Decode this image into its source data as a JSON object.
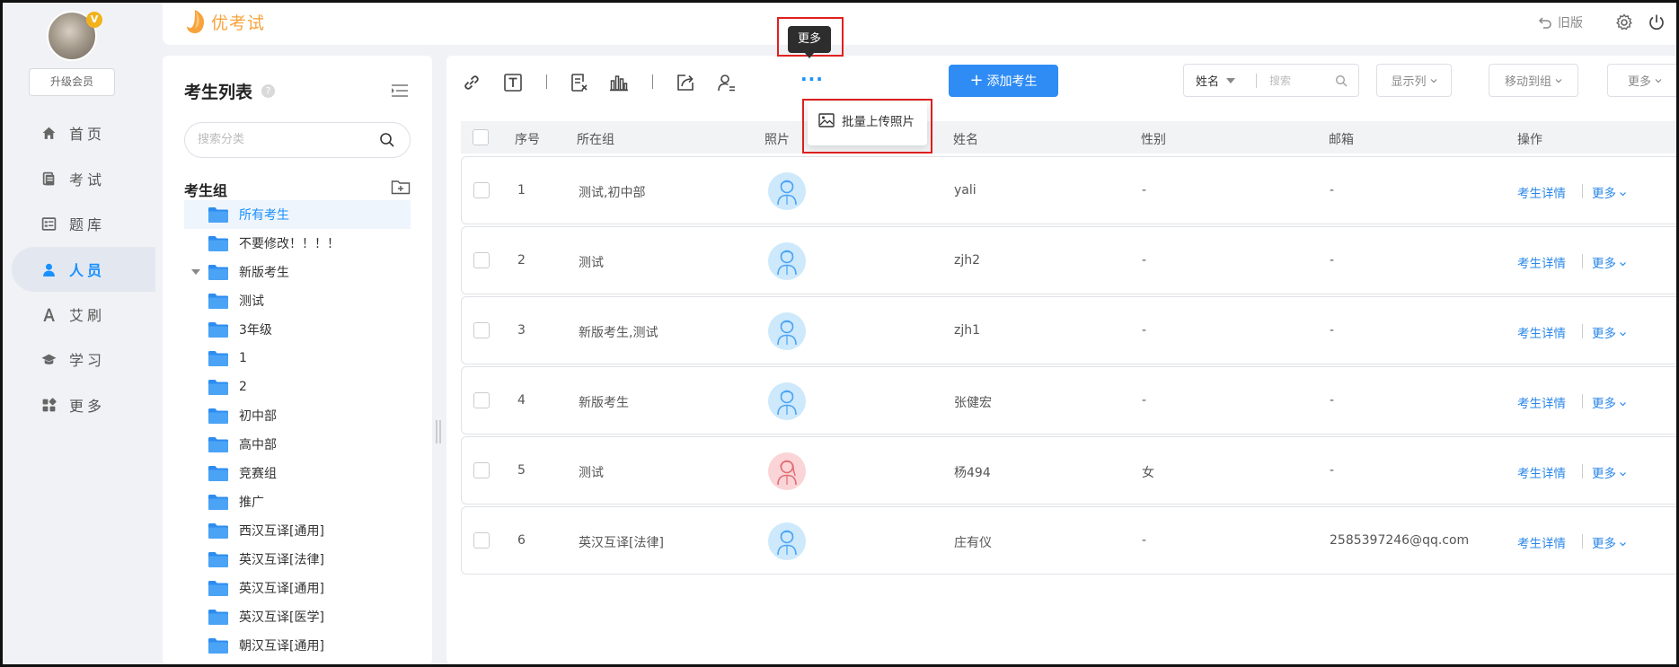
{
  "app": {
    "logo_text": "优考试"
  },
  "header": {
    "old_version_label": "旧版"
  },
  "user": {
    "upgrade_label": "升级会员",
    "badge": "V"
  },
  "nav": {
    "items": [
      {
        "label": "首页",
        "icon": "home-icon"
      },
      {
        "label": "考试",
        "icon": "exam-icon"
      },
      {
        "label": "题库",
        "icon": "question-bank-icon"
      },
      {
        "label": "人员",
        "icon": "person-icon",
        "active": true
      },
      {
        "label": "艾刷",
        "icon": "font-a-icon"
      },
      {
        "label": "学习",
        "icon": "graduation-cap-icon"
      },
      {
        "label": "更多",
        "icon": "apps-grid-icon"
      }
    ]
  },
  "category_panel": {
    "title": "考生列表",
    "help": "?",
    "search_placeholder": "搜索分类",
    "group_title": "考生组",
    "items": [
      "所有考生",
      "不要修改！！！！",
      "新版考生",
      "测试",
      "3年级",
      "1",
      "2",
      "初中部",
      "高中部",
      "竞赛组",
      "推广",
      "西汉互译[通用]",
      "英汉互译[法律]",
      "英汉互译[通用]",
      "英汉互译[医学]",
      "朝汉互译[通用]"
    ]
  },
  "toolbar": {
    "add_button": "添加考生",
    "more_dots": "···",
    "tooltip": "更多",
    "popup_item": "批量上传照片",
    "search_field_select": "姓名",
    "search_placeholder": "搜索",
    "show_columns": "显示列",
    "move_to_group": "移动到组",
    "more": "更多"
  },
  "table": {
    "headers": {
      "index": "序号",
      "group": "所在组",
      "photo": "照片",
      "name": "姓名",
      "gender": "性别",
      "email": "邮箱",
      "action": "操作"
    },
    "action_detail": "考生详情",
    "action_more": "更多",
    "rows": [
      {
        "index": "1",
        "group": "测试,初中部",
        "name": "yali",
        "gender": "-",
        "email": "-",
        "photo": "male"
      },
      {
        "index": "2",
        "group": "测试",
        "name": "zjh2",
        "gender": "-",
        "email": "-",
        "photo": "male"
      },
      {
        "index": "3",
        "group": "新版考生,测试",
        "name": "zjh1",
        "gender": "-",
        "email": "-",
        "photo": "male"
      },
      {
        "index": "4",
        "group": "新版考生",
        "name": "张健宏",
        "gender": "-",
        "email": "-",
        "photo": "male"
      },
      {
        "index": "5",
        "group": "测试",
        "name": "杨494",
        "gender": "女",
        "email": "-",
        "photo": "female"
      },
      {
        "index": "6",
        "group": "英汉互译[法律]",
        "name": "庄有仪",
        "gender": "-",
        "email": "2585397246@qq.com",
        "photo": "male"
      }
    ]
  },
  "colors": {
    "accent": "#1890ff",
    "button": "#2f8cf5",
    "highlight_border": "#e02020",
    "logo": "#f7a33b"
  }
}
